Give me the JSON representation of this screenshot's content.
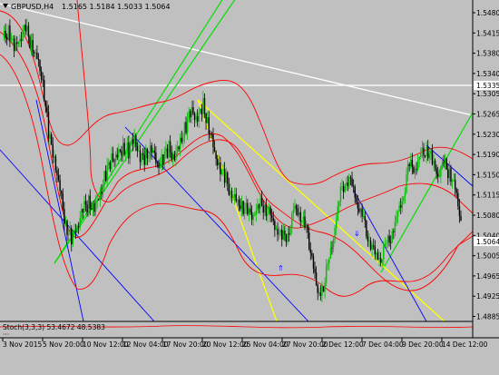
{
  "window": {
    "symbol_header": "GBPUSD,H4",
    "ohlc": "1.5165 1.5184 1.5033 1.5064"
  },
  "price_axis": {
    "ticks": [
      "1.5480",
      "1.5415",
      "1.5380",
      "1.5340",
      "1.5305",
      "1.5265",
      "1.5230",
      "1.5190",
      "1.5150",
      "1.5115",
      "1.5080",
      "1.5040",
      "1.5005",
      "1.4965",
      "1.4925",
      "1.4885"
    ],
    "current_price": "1.5064",
    "horizontal_line_label": "1.5335"
  },
  "time_axis": {
    "labels": [
      "3 Nov 2015",
      "5 Nov 20:00",
      "10 Nov 12:00",
      "12 Nov 04:00",
      "17 Nov 20:00",
      "20 Nov 12:00",
      "25 Nov 04:00",
      "27 Nov 20:00",
      "2 Dec 12:00",
      "7 Dec 04:00",
      "9 Dec 20:00",
      "14 Dec 12:00"
    ]
  },
  "indicator": {
    "label": "Stoch(3,3,3) 53.4672 48.5383"
  },
  "colors": {
    "background": "#c0c0c0",
    "bull_candle": "#00c000",
    "bear_candle": "#000000",
    "envelope": "#ff0000",
    "trend_green": "#00e000",
    "trend_yellow": "#ffff00",
    "trend_white": "#ffffff",
    "trend_blue": "#0000ff"
  },
  "chart_data": {
    "type": "candlestick",
    "symbol": "GBPUSD",
    "timeframe": "H4",
    "ylim": [
      1.4868,
      1.5492
    ],
    "last": {
      "open": 1.5165,
      "high": 1.5184,
      "close": 1.5064,
      "low": 1.5033
    },
    "horizontal_line": 1.5335,
    "close_path": [
      1.541,
      1.544,
      1.54,
      1.542,
      1.543,
      1.5405,
      1.538,
      1.534,
      1.523,
      1.518,
      1.512,
      1.506,
      1.503,
      1.505,
      1.508,
      1.51,
      1.509,
      1.512,
      1.515,
      1.518,
      1.519,
      1.521,
      1.52,
      1.522,
      1.518,
      1.519,
      1.521,
      1.517,
      1.518,
      1.52,
      1.519,
      1.522,
      1.525,
      1.527,
      1.526,
      1.529,
      1.525,
      1.519,
      1.516,
      1.514,
      1.512,
      1.51,
      1.509,
      1.507,
      1.508,
      1.51,
      1.509,
      1.506,
      1.504,
      1.503,
      1.505,
      1.509,
      1.507,
      1.504,
      1.5,
      1.492,
      1.494,
      1.498,
      1.505,
      1.512,
      1.515,
      1.513,
      1.509,
      1.506,
      1.503,
      1.5,
      1.499,
      1.501,
      1.504,
      1.508,
      1.512,
      1.517,
      1.516,
      1.519,
      1.521,
      1.518,
      1.515,
      1.517,
      1.516,
      1.513,
      1.5064
    ]
  }
}
